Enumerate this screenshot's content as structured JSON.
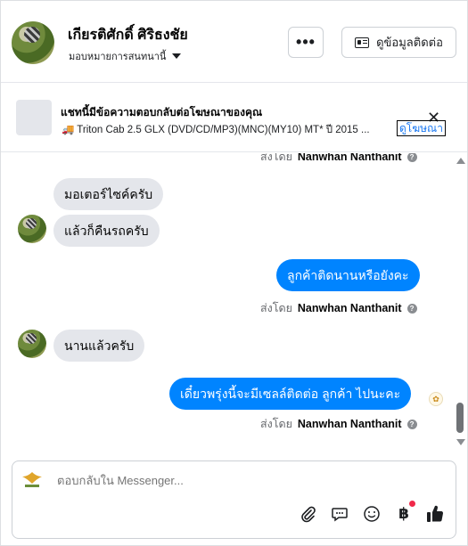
{
  "header": {
    "contact_name": "เกียรติศักดิ์ ศิริธงชัย",
    "assignment_status": "มอบหมายการสนทนานี้",
    "more_label": "•••",
    "contact_info_label": "ดูข้อมูลติดต่อ"
  },
  "ad_banner": {
    "title": "แชทนี้มีข้อความตอบกลับต่อโฆษณาของคุณ",
    "subtitle": "🚚 Triton Cab 2.5 GLX (DVD/CD/MP3)(MNC)(MY10) MT* ปี 2015 ...",
    "view_ad_label": "ดูโฆษณา",
    "close_label": "✕"
  },
  "messages": [
    {
      "type": "sent_by",
      "prefix": "ส่งโดย",
      "name": "Nanwhan Nanthanit"
    },
    {
      "type": "incoming",
      "text": "มอเตอร์ไซค์ครับ"
    },
    {
      "type": "incoming",
      "text": "แล้วก็คืนรถครับ"
    },
    {
      "type": "outgoing",
      "text": "ลูกค้าติดนานหรือยังคะ"
    },
    {
      "type": "sent_by",
      "prefix": "ส่งโดย",
      "name": "Nanwhan Nanthanit"
    },
    {
      "type": "incoming",
      "text": "นานแล้วครับ"
    },
    {
      "type": "outgoing",
      "text": "เดี๋ยวพรุ่งนี้จะมีเซลล์ติดต่อ ลูกค้า ไปนะคะ"
    },
    {
      "type": "sent_by",
      "prefix": "ส่งโดย",
      "name": "Nanwhan Nanthanit"
    }
  ],
  "composer": {
    "placeholder": "ตอบกลับใน Messenger..."
  },
  "icons": {
    "attach": "paperclip-icon",
    "saved_replies": "chat-bubble-icon",
    "emoji": "smiley-icon",
    "payment": "baht-icon",
    "like": "thumbs-up-icon"
  },
  "colors": {
    "outgoing_bubble": "#0084ff",
    "incoming_bubble": "#e4e6eb",
    "link": "#1877f2",
    "notification_dot": "#f02849"
  }
}
